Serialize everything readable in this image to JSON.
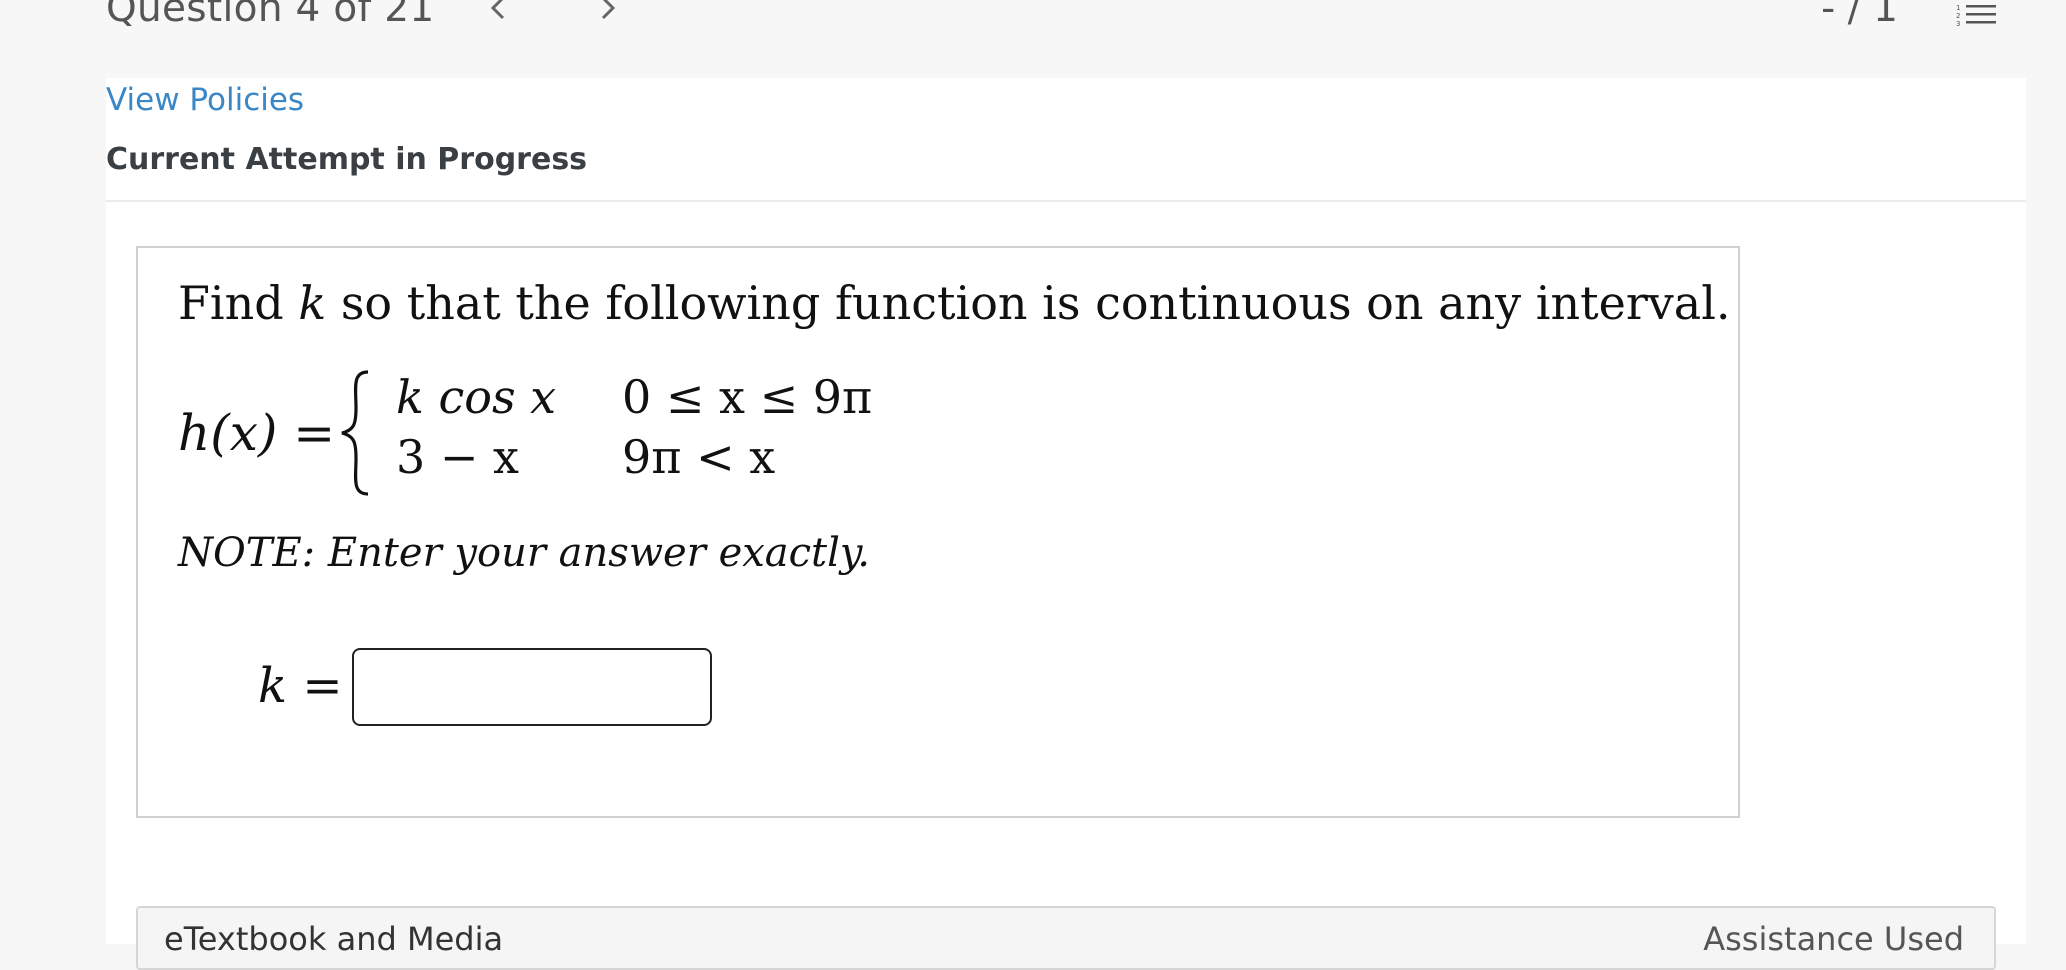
{
  "header": {
    "question_counter": "Question 4 of 21",
    "score": "- / 1",
    "prev_icon": "chevron-left-icon",
    "next_icon": "chevron-right-icon",
    "list_icon": "numbered-list-icon"
  },
  "policies_link": "View Policies",
  "attempt_status": "Current Attempt in Progress",
  "question": {
    "statement_pre": "Find ",
    "statement_var": "k",
    "statement_post": " so that the following function is continuous on any interval.",
    "function_name": "h(x) =",
    "cases": [
      {
        "expr": "k cos x",
        "cond": "0 ≤ x ≤ 9π"
      },
      {
        "expr": "3 − x",
        "cond": "9π < x"
      }
    ],
    "note": "NOTE:  Enter your answer exactly.",
    "answer_label": "k =",
    "answer_value": ""
  },
  "etext": {
    "title": "eTextbook and Media",
    "right": "Assistance Used"
  },
  "colors": {
    "link": "#3a87c8",
    "page_bg": "#f7f7f7",
    "panel_bg": "#ffffff"
  }
}
